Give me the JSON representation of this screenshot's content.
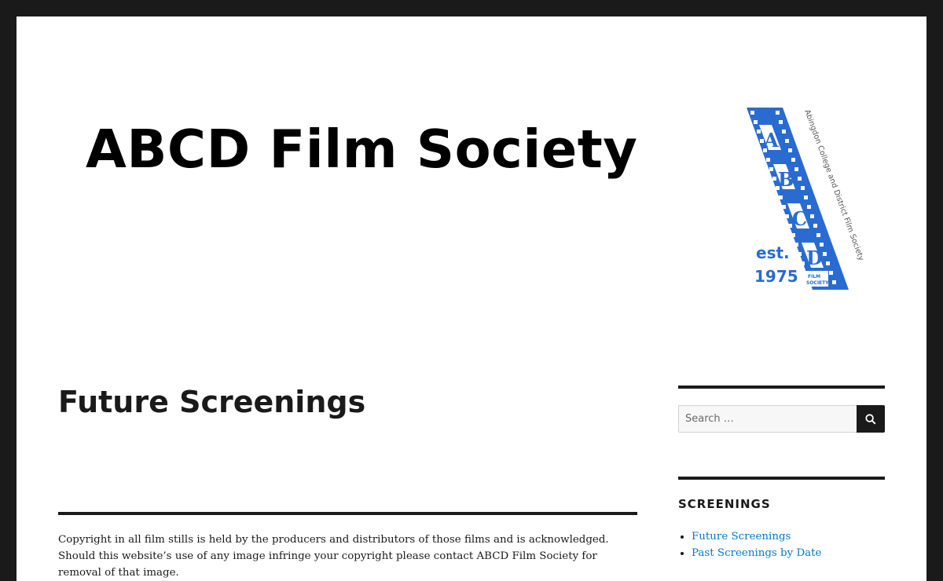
{
  "header": {
    "site_title": "ABCD Film Society",
    "logo": {
      "letters": [
        "A",
        "B",
        "C",
        "D"
      ],
      "tagline": "Abingdon College and District Film Society",
      "est": "est.",
      "year": "1975",
      "badge_line1": "FILM",
      "badge_line2": "SOCIETY",
      "brand_color": "#2a6bd1"
    }
  },
  "main": {
    "page_title": "Future Screenings",
    "copyright_note": "Copyright in all film stills is held by the producers and distributors of those films and is acknowledged. Should this website’s use of any image infringe your copyright please contact ABCD Film Society for removal of that image."
  },
  "sidebar": {
    "search": {
      "placeholder": "Search …",
      "button_icon": "search-icon"
    },
    "screenings_widget": {
      "title": "SCREENINGS",
      "links": [
        {
          "label": "Future Screenings"
        },
        {
          "label": "Past Screenings by Date"
        }
      ]
    }
  },
  "colors": {
    "link": "#007acc",
    "text": "#1a1a1a",
    "frame": "#1a1a1a"
  }
}
